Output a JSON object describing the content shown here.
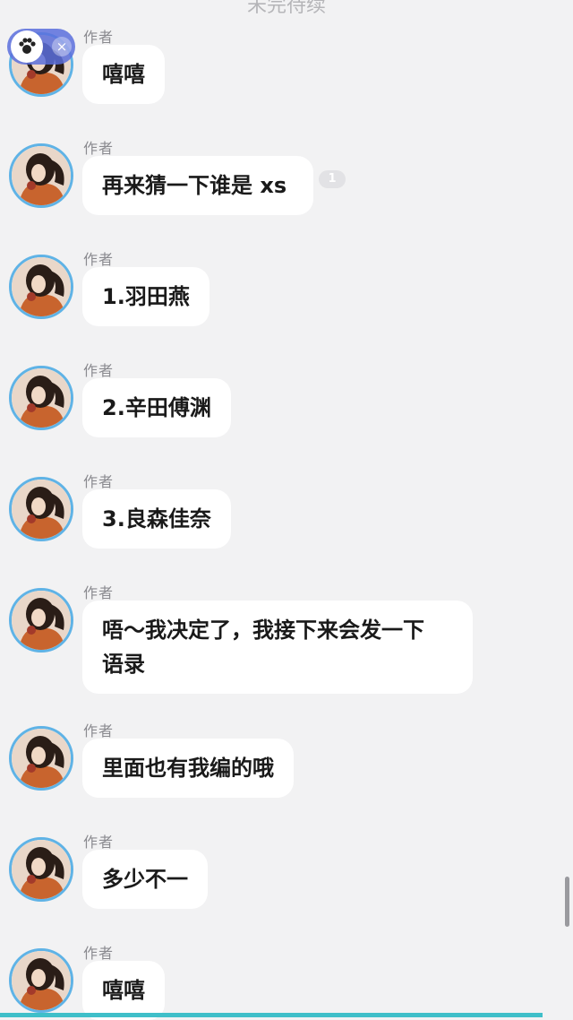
{
  "header": {
    "title": "未完待续"
  },
  "float_widget": {
    "close_glyph": "×",
    "icon": "paw-icon"
  },
  "messages": [
    {
      "author": "作者",
      "text": "嘻嘻"
    },
    {
      "author": "作者",
      "text": "再来猜一下谁是 xs",
      "badge": "1"
    },
    {
      "author": "作者",
      "text": "1.羽田燕"
    },
    {
      "author": "作者",
      "text": "2.辛田傅渊"
    },
    {
      "author": "作者",
      "text": "3.良森佳奈"
    },
    {
      "author": "作者",
      "line1": "唔～我决定了，我接下来会发一下",
      "line2": "语录"
    },
    {
      "author": "作者",
      "text": "里面也有我编的哦"
    },
    {
      "author": "作者",
      "text": "多少不一"
    },
    {
      "author": "作者",
      "text": "嘻嘻"
    }
  ],
  "colors": {
    "accent": "#3fbfc9",
    "avatar_ring": "#5fb3e6",
    "widget": "#5a6edc"
  }
}
